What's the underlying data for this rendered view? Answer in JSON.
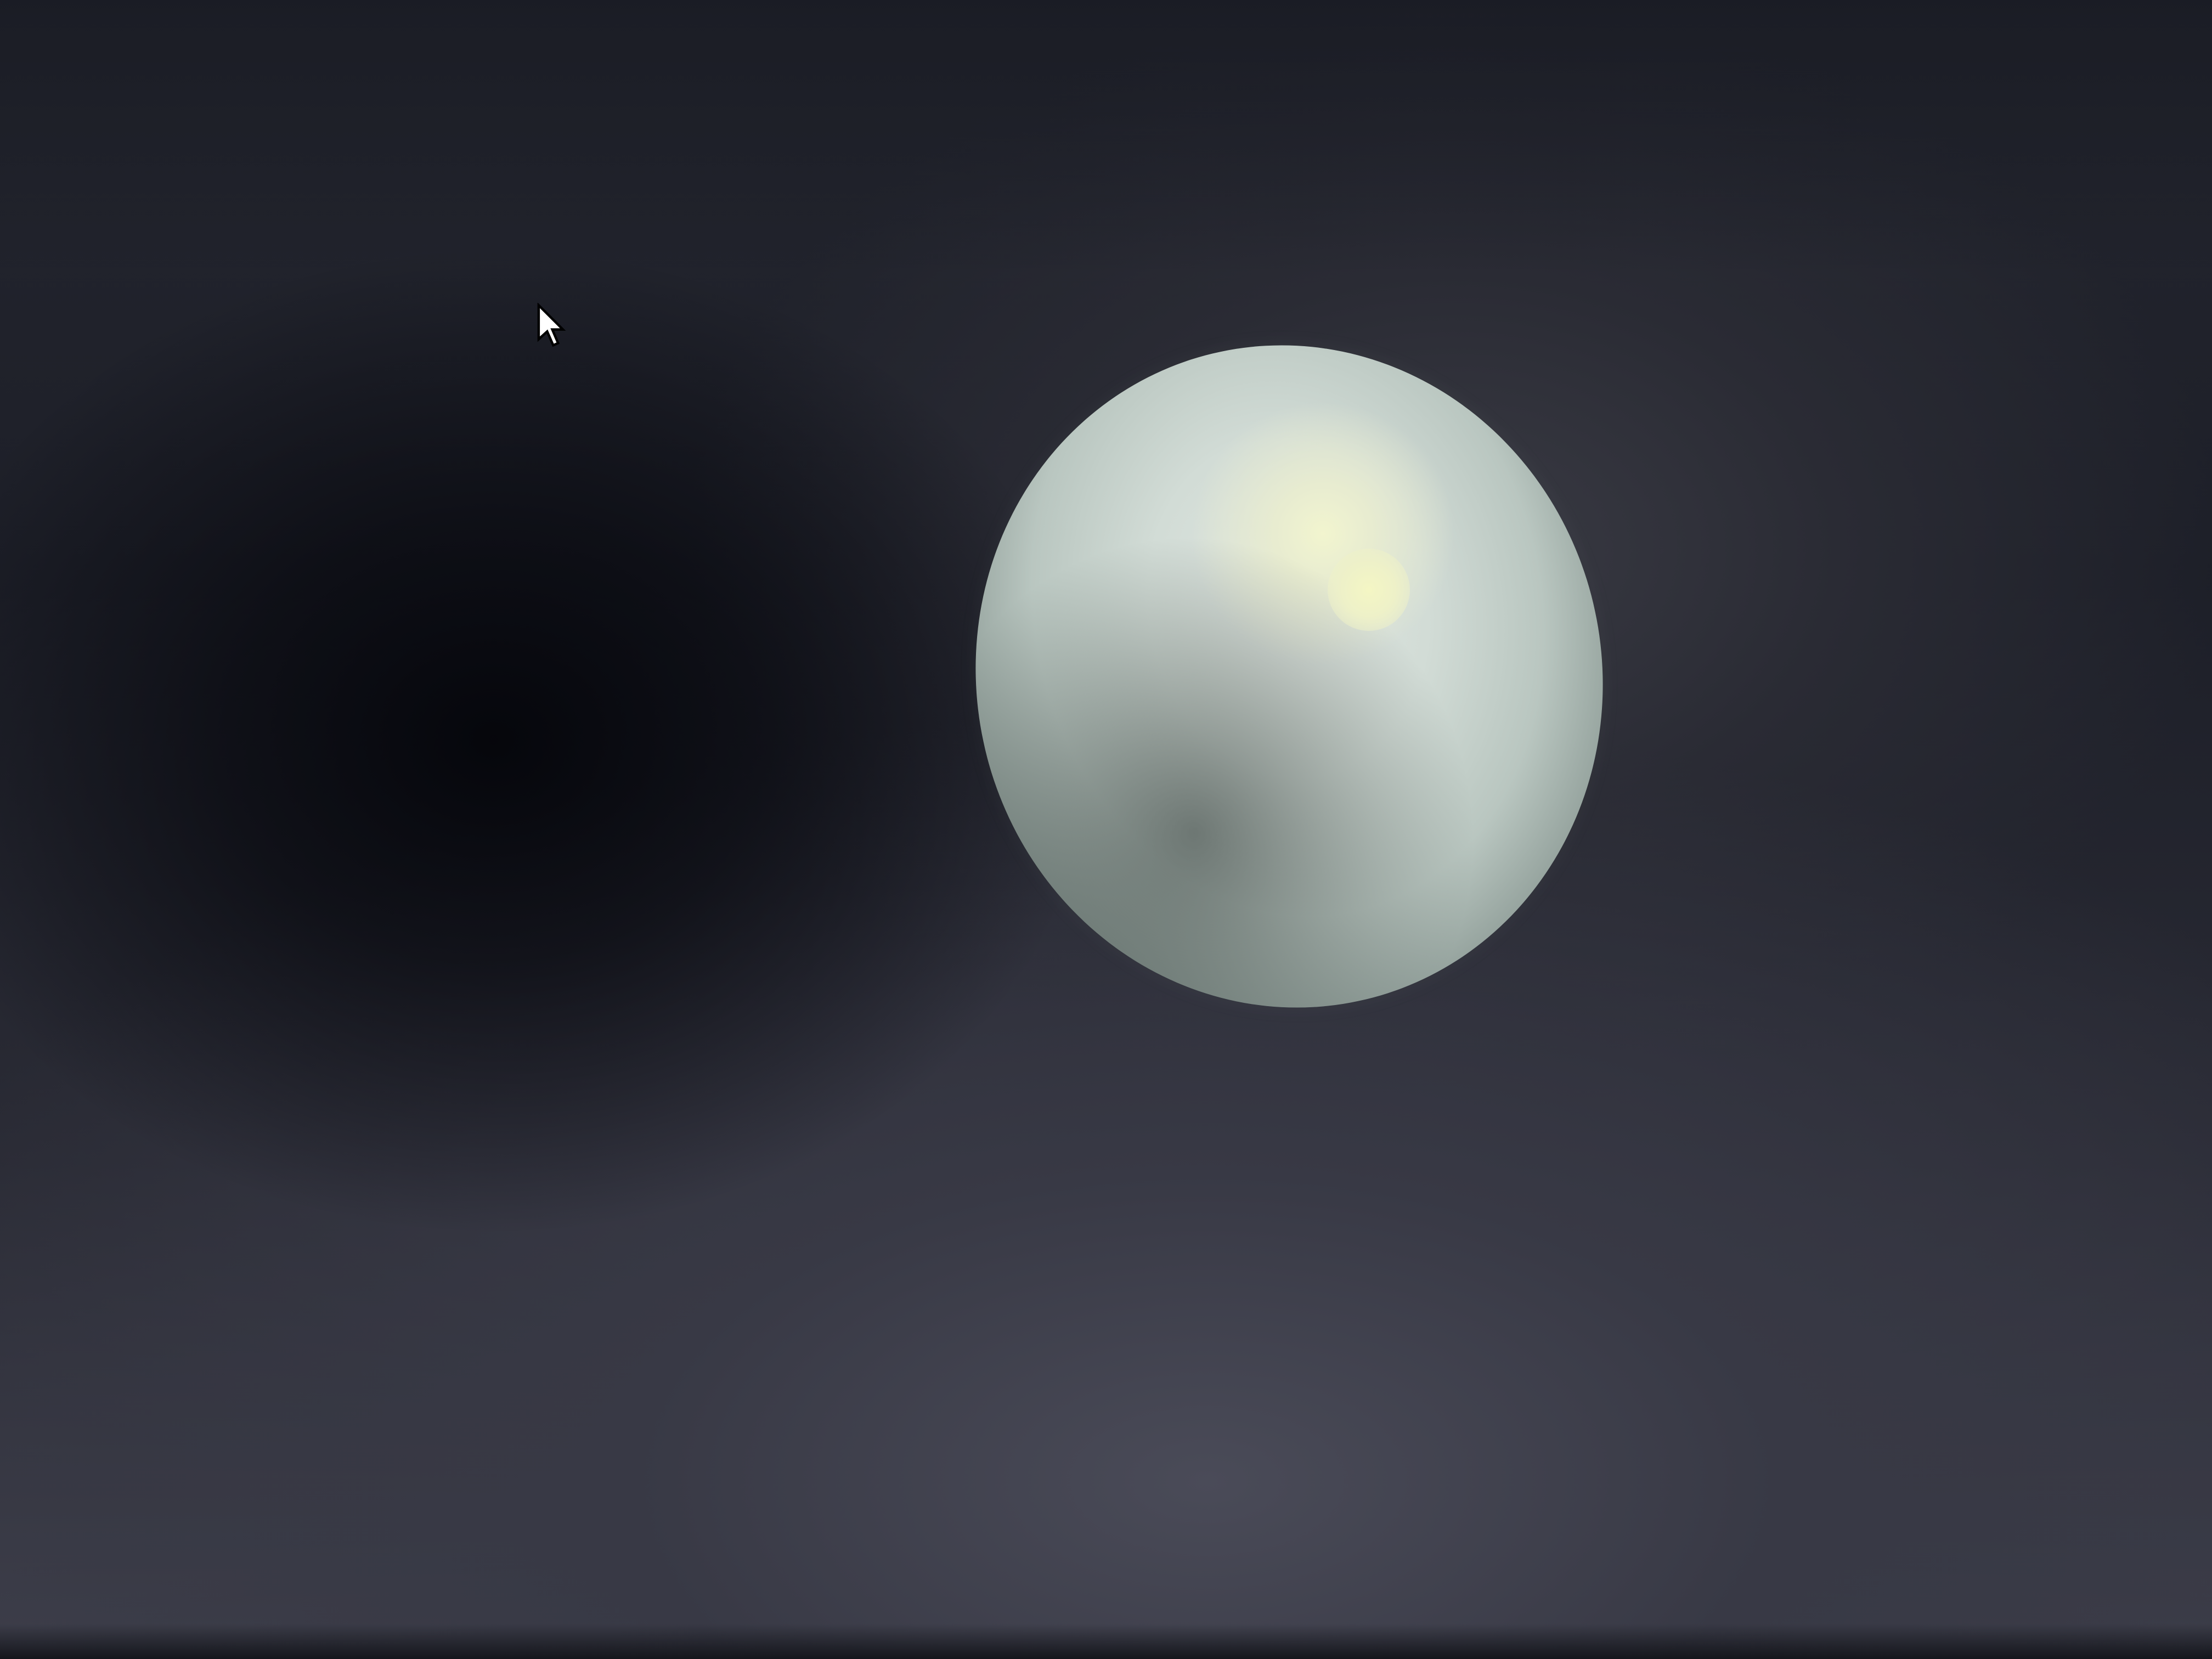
{
  "scene": {
    "background_color": "#1a1c24",
    "sphere": {
      "base_color": "#d2dcd6",
      "highlight_color": "#f2f5cf"
    }
  },
  "cursor": {
    "icon": "arrow-pointer-icon",
    "color": "#ffffff",
    "outline": "#000000"
  }
}
